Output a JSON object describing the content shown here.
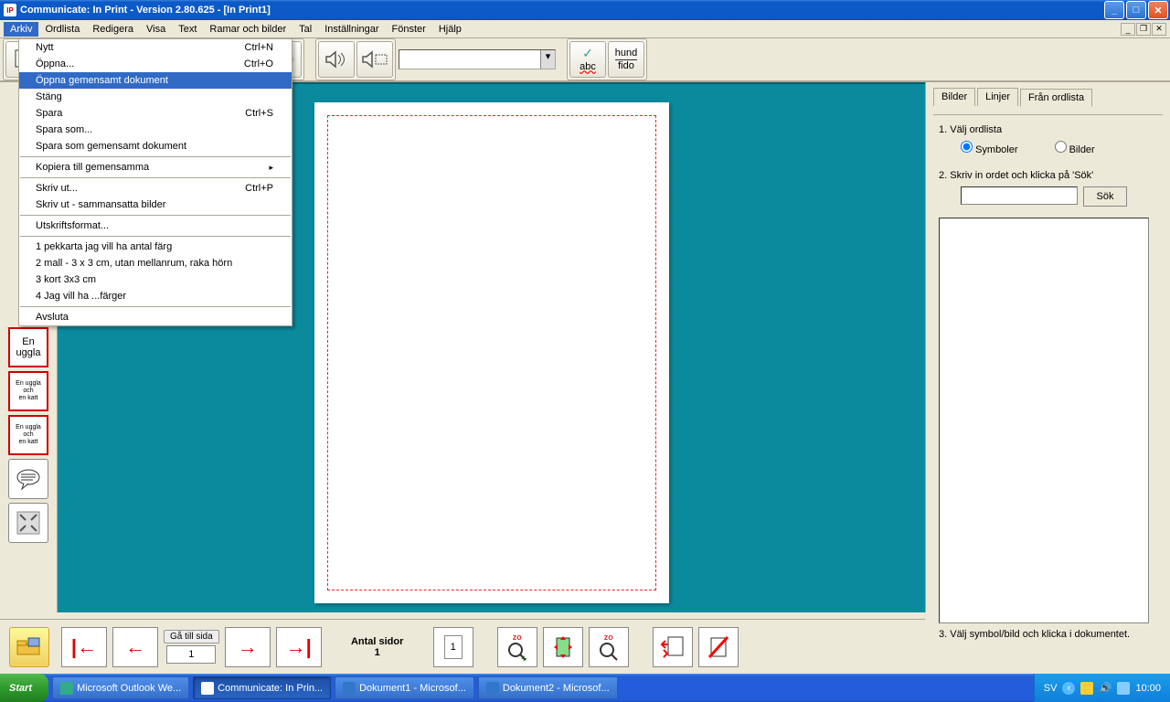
{
  "title": "Communicate: In Print - Version 2.80.625 - [In Print1]",
  "menubar": [
    "Arkiv",
    "Ordlista",
    "Redigera",
    "Visa",
    "Text",
    "Ramar och bilder",
    "Tal",
    "Inställningar",
    "Fönster",
    "Hjälp"
  ],
  "arkiv_menu": {
    "items": [
      {
        "label": "Nytt",
        "shortcut": "Ctrl+N"
      },
      {
        "label": "Öppna...",
        "shortcut": "Ctrl+O"
      },
      {
        "label": "Öppna gemensamt dokument",
        "highlight": true
      },
      {
        "label": "Stäng"
      },
      {
        "label": "Spara",
        "shortcut": "Ctrl+S"
      },
      {
        "label": "Spara som..."
      },
      {
        "label": "Spara som gemensamt dokument"
      },
      {
        "sep": true
      },
      {
        "label": "Kopiera till gemensamma",
        "submenu": true
      },
      {
        "sep": true
      },
      {
        "label": "Skriv ut...",
        "shortcut": "Ctrl+P"
      },
      {
        "label": "Skriv ut - sammansatta bilder"
      },
      {
        "sep": true
      },
      {
        "label": "Utskriftsformat..."
      },
      {
        "sep": true
      },
      {
        "label": "1 pekkarta jag vill ha antal färg"
      },
      {
        "label": "2 mall - 3 x 3 cm, utan mellanrum, raka hörn"
      },
      {
        "label": "3 kort 3x3 cm"
      },
      {
        "label": "4 Jag vill ha ...färger"
      },
      {
        "sep": true
      },
      {
        "label": "Avsluta"
      }
    ]
  },
  "toolbar_text": {
    "abc": "abc",
    "hund": "hund",
    "fido": "fido"
  },
  "left_buttons": {
    "enuggla": "En uggla",
    "enugglakatt": "En uggla\noch\nen katt",
    "enugglakatt2": "En uggla\noch\nen katt"
  },
  "rightpanel": {
    "tabs": [
      "Bilder",
      "Linjer",
      "Från ordlista"
    ],
    "active_tab": 2,
    "step1": "1. Välj ordlista",
    "radio_symboler": "Symboler",
    "radio_bilder": "Bilder",
    "step2": "2. Skriv in ordet och klicka på 'Sök'",
    "sok": "Sök",
    "step3": "3. Välj symbol/bild och klicka i dokumentet."
  },
  "bottombar": {
    "ga_till_sida": "Gå till sida",
    "page_input": "1",
    "antal_sidor_label": "Antal sidor",
    "antal_sidor": "1",
    "thumb_page": "1"
  },
  "taskbar": {
    "start": "Start",
    "tasks": [
      "Microsoft Outlook We...",
      "Communicate: In Prin...",
      "Dokument1 - Microsof...",
      "Dokument2 - Microsof..."
    ],
    "lang": "SV",
    "clock": "10:00"
  }
}
